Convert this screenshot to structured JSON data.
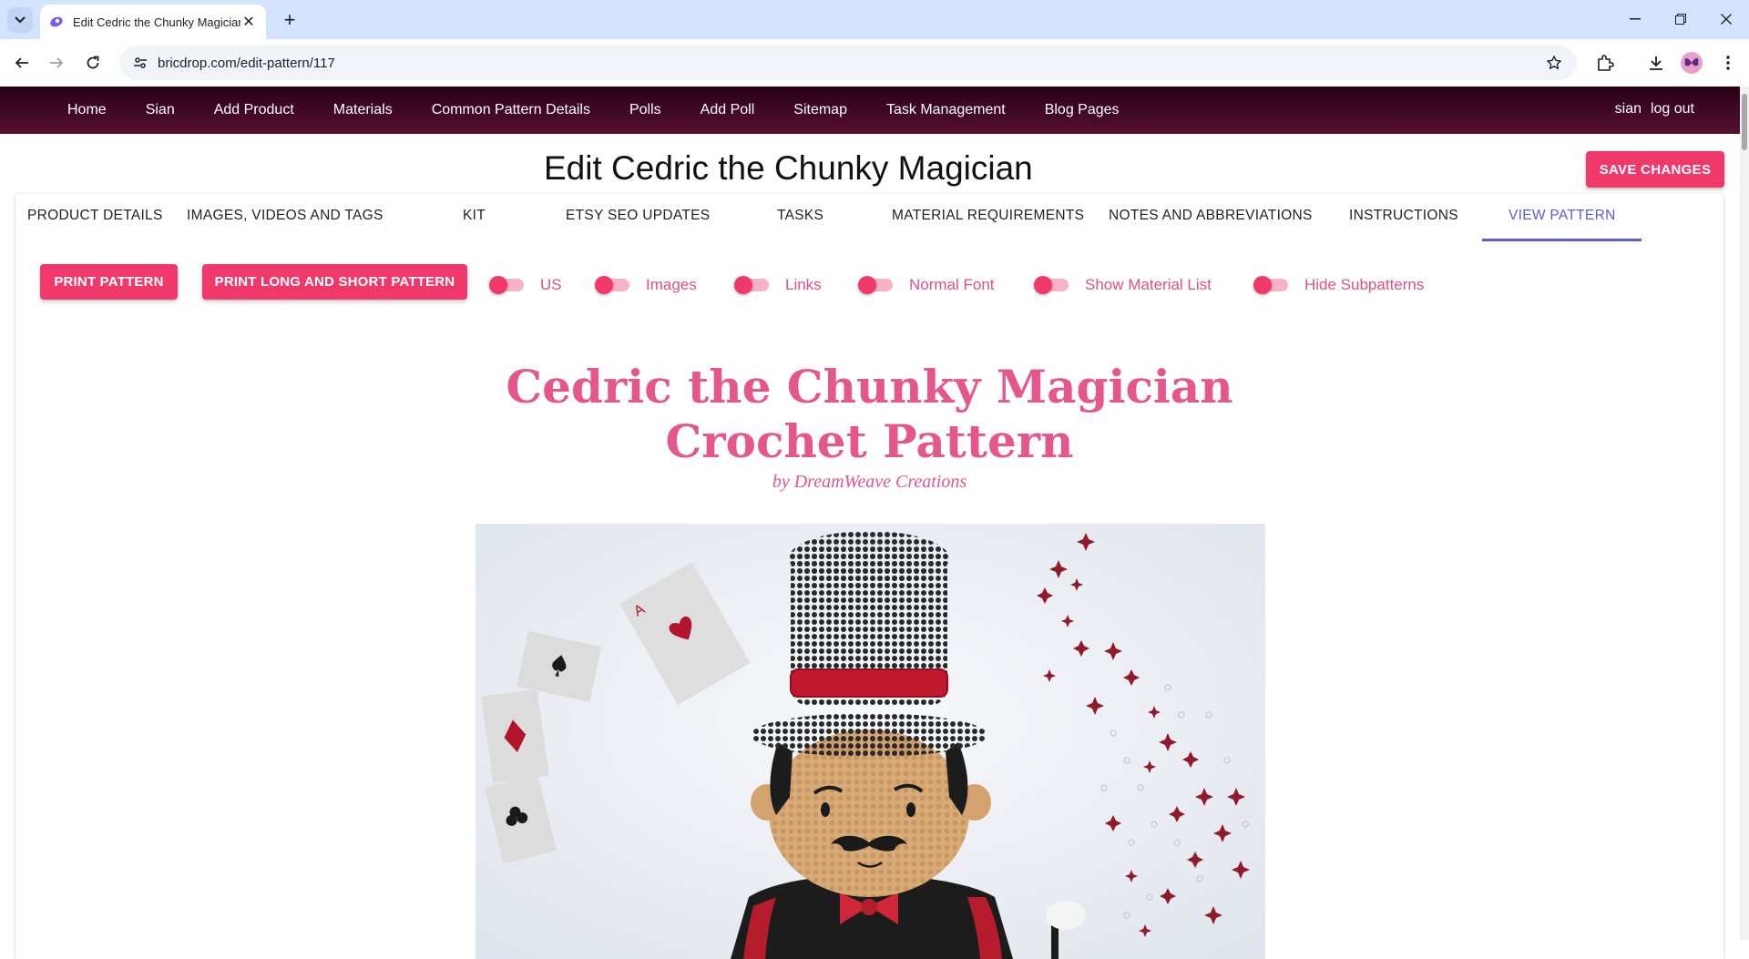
{
  "browser": {
    "tab_title": "Edit Cedric the Chunky Magician",
    "url": "bricdrop.com/edit-pattern/117"
  },
  "sitenav": {
    "links": [
      "Home",
      "Sian",
      "Add Product",
      "Materials",
      "Common Pattern Details",
      "Polls",
      "Add Poll",
      "Sitemap",
      "Task Management",
      "Blog Pages"
    ],
    "user": "sian",
    "logout": "log out"
  },
  "page": {
    "title": "Edit Cedric the Chunky Magician",
    "save_label": "SAVE CHANGES"
  },
  "tabs": [
    {
      "label": "PRODUCT DETAILS"
    },
    {
      "label": "IMAGES, VIDEOS AND TAGS"
    },
    {
      "label": "KIT"
    },
    {
      "label": "ETSY SEO UPDATES"
    },
    {
      "label": "TASKS"
    },
    {
      "label": "MATERIAL REQUIREMENTS"
    },
    {
      "label": "NOTES AND ABBREVIATIONS"
    },
    {
      "label": "INSTRUCTIONS"
    },
    {
      "label": "VIEW PATTERN",
      "active": true
    }
  ],
  "actions": {
    "print_pattern": "PRINT PATTERN",
    "print_long_short": "PRINT LONG AND SHORT PATTERN"
  },
  "toggles": [
    {
      "label": "US",
      "on": false
    },
    {
      "label": "Images",
      "on": false
    },
    {
      "label": "Links",
      "on": false
    },
    {
      "label": "Normal Font",
      "on": false
    },
    {
      "label": "Show Material List",
      "on": false
    },
    {
      "label": "Hide Subpatterns",
      "on": false
    }
  ],
  "pattern": {
    "title_line1": "Cedric the Chunky Magician",
    "title_line2": "Crochet Pattern",
    "byline": "by DreamWeave Creations"
  },
  "colors": {
    "accent": "#f0386b",
    "title_pink": "#e4568c",
    "active_tab": "#5b5bd6",
    "nav_bg": "#3b0520"
  }
}
